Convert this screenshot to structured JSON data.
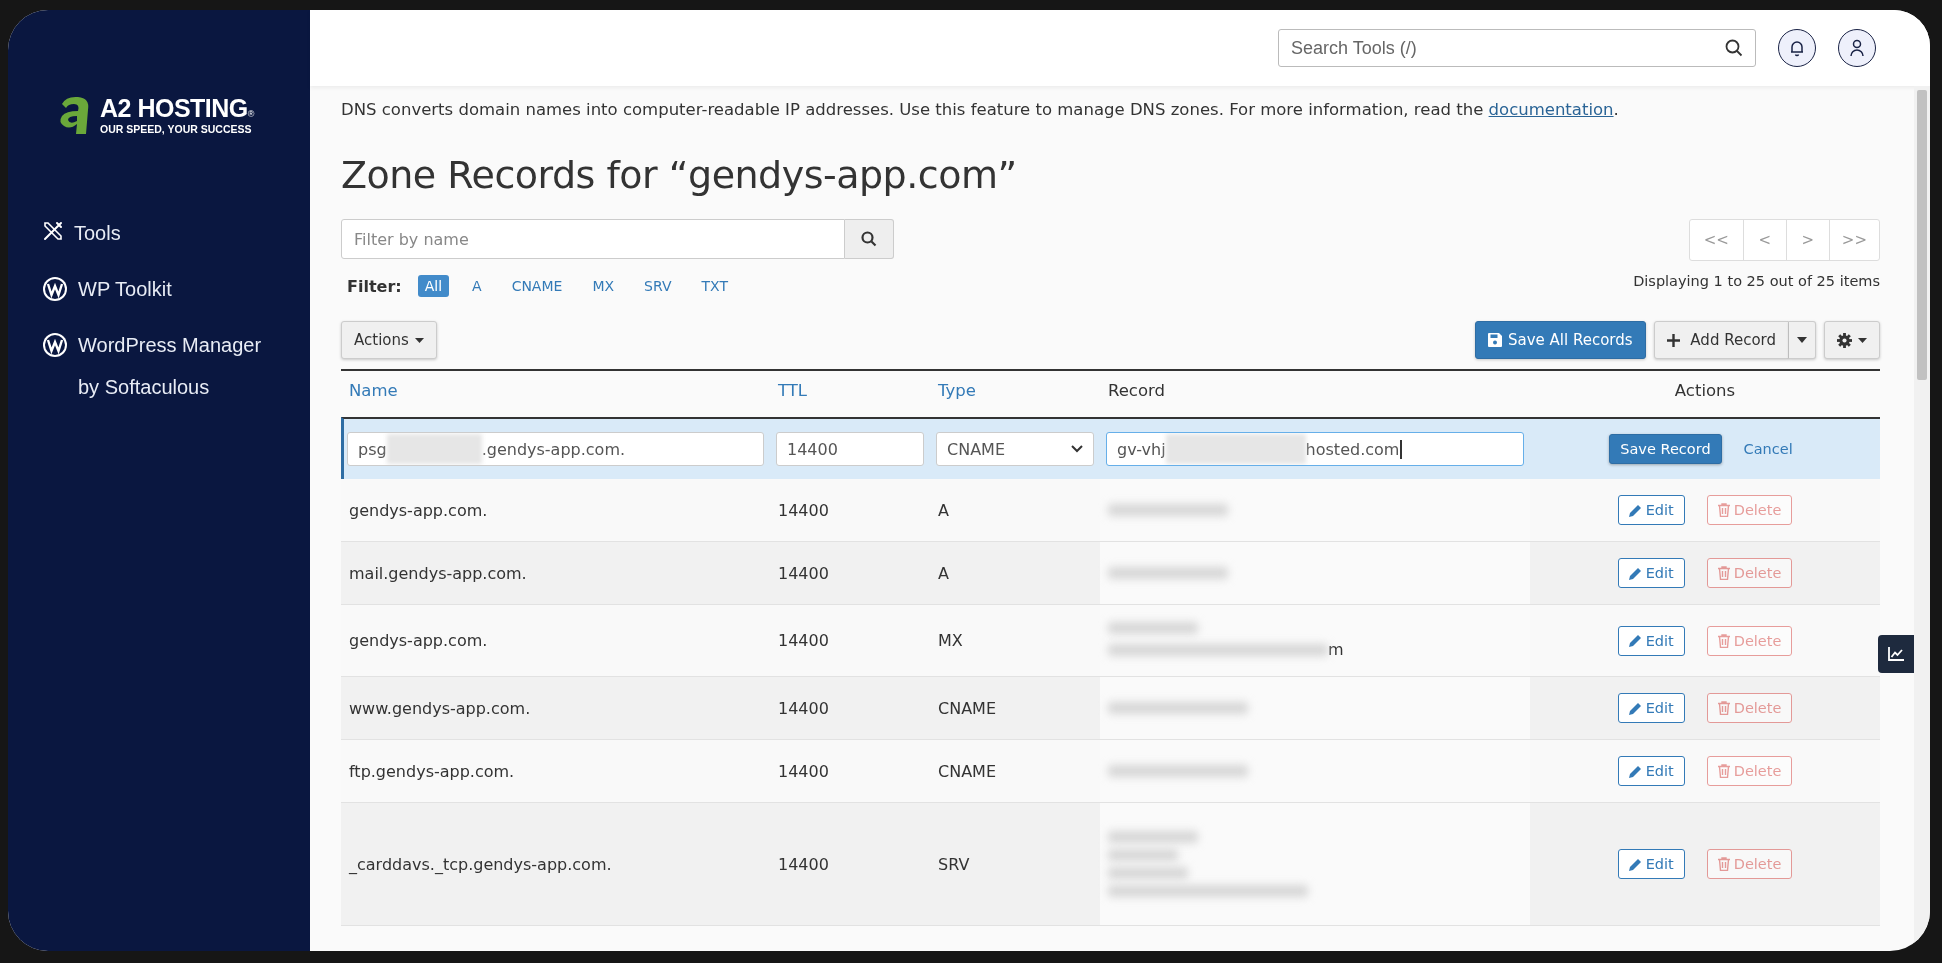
{
  "sidebar": {
    "logo": {
      "brand": "A2 HOSTING",
      "mark": "®",
      "tagline": "OUR SPEED, YOUR SUCCESS"
    },
    "items": [
      {
        "label": "Tools",
        "kind": "tools"
      },
      {
        "label": "WP Toolkit",
        "kind": "wordpress"
      },
      {
        "label": "WordPress Manager by Softaculous",
        "kind": "wordpress"
      }
    ]
  },
  "header": {
    "search": {
      "placeholder": "Search Tools (/)"
    }
  },
  "intro": {
    "text": "DNS converts domain names into computer-readable IP addresses. Use this feature to manage DNS zones. For more information, read the ",
    "link": "documentation",
    "end": "."
  },
  "title": "Zone Records for “gendys-app.com”",
  "filter_field": {
    "placeholder": "Filter by name"
  },
  "filter": {
    "label": "Filter:",
    "options": [
      {
        "label": "All",
        "selected": true
      },
      {
        "label": "A",
        "selected": false
      },
      {
        "label": "CNAME",
        "selected": false
      },
      {
        "label": "MX",
        "selected": false
      },
      {
        "label": "SRV",
        "selected": false
      },
      {
        "label": "TXT",
        "selected": false
      }
    ]
  },
  "actions_button": "Actions",
  "pagination": {
    "buttons": [
      "<<",
      "<",
      ">",
      ">>"
    ],
    "summary": "Displaying 1 to 25 out of 25 items"
  },
  "toolbar": {
    "save_all": "Save All Records",
    "add": "Add Record"
  },
  "table": {
    "columns": [
      {
        "label": "Name",
        "sortable": true
      },
      {
        "label": "TTL",
        "sortable": true
      },
      {
        "label": "Type",
        "sortable": true
      },
      {
        "label": "Record",
        "sortable": false
      },
      {
        "label": "Actions",
        "sortable": false
      }
    ],
    "edit_row": {
      "name_prefix": "psg",
      "name_suffix": ".gendys-app.com.",
      "ttl": "14400",
      "type": "CNAME",
      "record_prefix": "gv-vhj",
      "record_suffix": "hosted.com",
      "save": "Save Record",
      "cancel": "Cancel"
    },
    "rows": [
      {
        "name": "gendys-app.com.",
        "ttl": "14400",
        "type": "A",
        "edit": "Edit",
        "delete": "Delete"
      },
      {
        "name": "mail.gendys-app.com.",
        "ttl": "14400",
        "type": "A",
        "edit": "Edit",
        "delete": "Delete"
      },
      {
        "name": "gendys-app.com.",
        "ttl": "14400",
        "type": "MX",
        "record_tail": "m",
        "edit": "Edit",
        "delete": "Delete"
      },
      {
        "name": "www.gendys-app.com.",
        "ttl": "14400",
        "type": "CNAME",
        "edit": "Edit",
        "delete": "Delete"
      },
      {
        "name": "ftp.gendys-app.com.",
        "ttl": "14400",
        "type": "CNAME",
        "edit": "Edit",
        "delete": "Delete"
      },
      {
        "name": "_carddavs._tcp.gendys-app.com.",
        "ttl": "14400",
        "type": "SRV",
        "edit": "Edit",
        "delete": "Delete"
      }
    ]
  }
}
